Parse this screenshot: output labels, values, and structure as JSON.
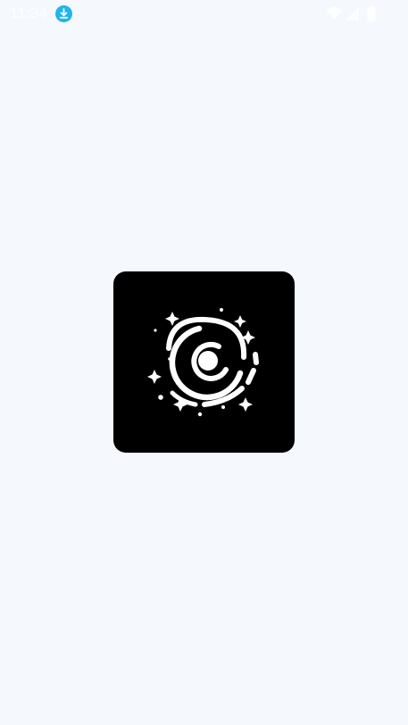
{
  "status_bar": {
    "time": "11:34",
    "download_icon": "download-icon",
    "wifi_icon": "wifi-icon",
    "signal_icon": "cellular-signal-icon",
    "battery_icon": "battery-icon"
  },
  "splash": {
    "logo_icon": "galaxy-spiral-logo"
  },
  "colors": {
    "background": "#f5f9fe",
    "logo_background": "#000000",
    "logo_foreground": "#ffffff",
    "download_badge": "#1fb5ee"
  }
}
